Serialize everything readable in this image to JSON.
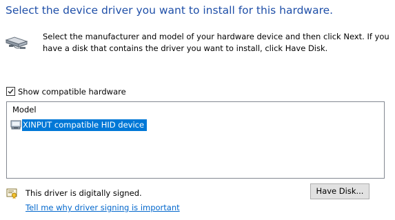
{
  "header": {
    "title": "Select the device driver you want to install for this hardware."
  },
  "instructions": {
    "text": "Select the manufacturer and model of your hardware device and then click Next. If you have a disk that contains the driver you want to install, click Have Disk."
  },
  "compatible": {
    "label": "Show compatible hardware",
    "checked": true
  },
  "model_list": {
    "column_header": "Model",
    "items": [
      {
        "label": "XINPUT compatible HID device",
        "selected": true,
        "icon": "device-icon"
      }
    ]
  },
  "signing": {
    "status": "This driver is digitally signed.",
    "link": "Tell me why driver signing is important",
    "icon": "certificate-icon"
  },
  "buttons": {
    "have_disk": "Have Disk..."
  },
  "colors": {
    "title": "#1f4fa8",
    "selection": "#0078d7",
    "link": "#0066cc"
  }
}
